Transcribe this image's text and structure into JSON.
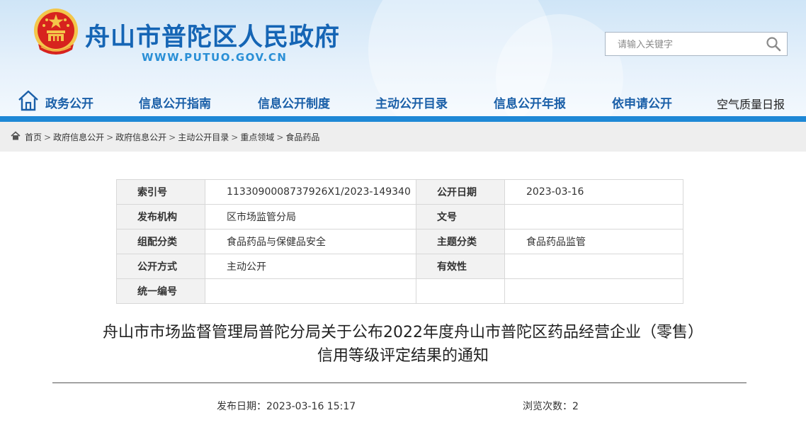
{
  "site": {
    "title": "舟山市普陀区人民政府",
    "url": "WWW.PUTUO.GOV.CN"
  },
  "search": {
    "placeholder": "请输入关键字"
  },
  "nav": {
    "items": [
      "政务公开",
      "信息公开指南",
      "信息公开制度",
      "主动公开目录",
      "信息公开年报",
      "依申请公开"
    ],
    "extra": "空气质量日报"
  },
  "breadcrumb": [
    "首页",
    "政府信息公开",
    "政府信息公开",
    "主动公开目录",
    "重点领域",
    "食品药品"
  ],
  "meta": {
    "index_label": "索引号",
    "index_value": "1133090008737926X1/2023-149340",
    "pubdate_label": "公开日期",
    "pubdate_value": "2023-03-16",
    "org_label": "发布机构",
    "org_value": "区市场监管分局",
    "docno_label": "文号",
    "docno_value": "",
    "category_label": "组配分类",
    "category_value": "食品药品与保健品安全",
    "topic_label": "主题分类",
    "topic_value": "食品药品监管",
    "method_label": "公开方式",
    "method_value": "主动公开",
    "validity_label": "有效性",
    "validity_value": "",
    "code_label": "统一编号",
    "code_value": ""
  },
  "article": {
    "title_line1": "舟山市市场监督管理局普陀分局关于公布2022年度舟山市普陀区药品经营企业（零售）",
    "title_line2": "信用等级评定结果的通知",
    "publish_date": "发布日期：2023-03-16 15:17",
    "views": "浏览次数：2"
  },
  "colors": {
    "brand": "#1565b5",
    "nav_bar": "#1e88d6",
    "emblem_red": "#d7231e",
    "emblem_gold": "#f3c64a"
  }
}
